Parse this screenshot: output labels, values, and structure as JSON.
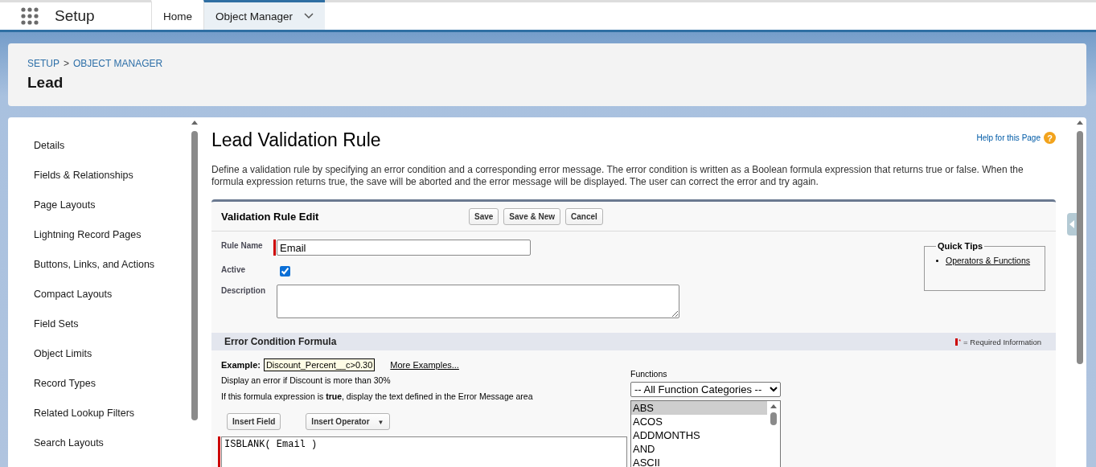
{
  "app": {
    "title": "Setup"
  },
  "nav_tabs": [
    {
      "label": "Home",
      "selected": false,
      "has_menu": false
    },
    {
      "label": "Object Manager",
      "selected": true,
      "has_menu": true
    }
  ],
  "header": {
    "breadcrumbs": [
      "SETUP",
      "OBJECT MANAGER"
    ],
    "separator": ">",
    "title": "Lead"
  },
  "sidebar": {
    "items": [
      "Details",
      "Fields & Relationships",
      "Page Layouts",
      "Lightning Record Pages",
      "Buttons, Links, and Actions",
      "Compact Layouts",
      "Field Sets",
      "Object Limits",
      "Record Types",
      "Related Lookup Filters",
      "Search Layouts"
    ]
  },
  "page": {
    "title": "Lead Validation Rule",
    "help_link": "Help for this Page",
    "help_icon": "?",
    "description": "Define a validation rule by specifying an error condition and a corresponding error message. The error condition is written as a Boolean formula expression that returns true or false. When the formula expression returns true, the save will be aborted and the error message will be displayed. The user can correct the error and try again."
  },
  "edit_panel": {
    "title": "Validation Rule Edit",
    "buttons": [
      "Save",
      "Save & New",
      "Cancel"
    ],
    "rule_name": {
      "label": "Rule Name",
      "value": "Email",
      "required": true
    },
    "active": {
      "label": "Active",
      "checked": true
    },
    "description": {
      "label": "Description"
    },
    "quick_tips": {
      "title": "Quick Tips",
      "links": [
        "Operators & Functions"
      ]
    }
  },
  "formula_section": {
    "title": "Error Condition Formula",
    "required_legend": "= Required Information",
    "required_mark": "*",
    "example_label": "Example:",
    "example_value": "Discount_Percent__c>0.30",
    "more_examples": "More Examples...",
    "example_note": "Display an error if Discount is more than 30%",
    "hint": "If this formula expression is **true**, display the text defined in the Error Message area",
    "insert_field": "Insert Field",
    "insert_operator": "Insert Operator",
    "operator_caret": "▼",
    "formula": "ISBLANK( Email )",
    "functions_label": "Functions",
    "category": "-- All Function Categories --",
    "functions": [
      {
        "name": "ABS",
        "selected": true
      },
      {
        "name": "ACOS",
        "selected": false
      },
      {
        "name": "ADDMONTHS",
        "selected": false
      },
      {
        "name": "AND",
        "selected": false
      },
      {
        "name": "ASCII",
        "selected": false
      }
    ]
  }
}
